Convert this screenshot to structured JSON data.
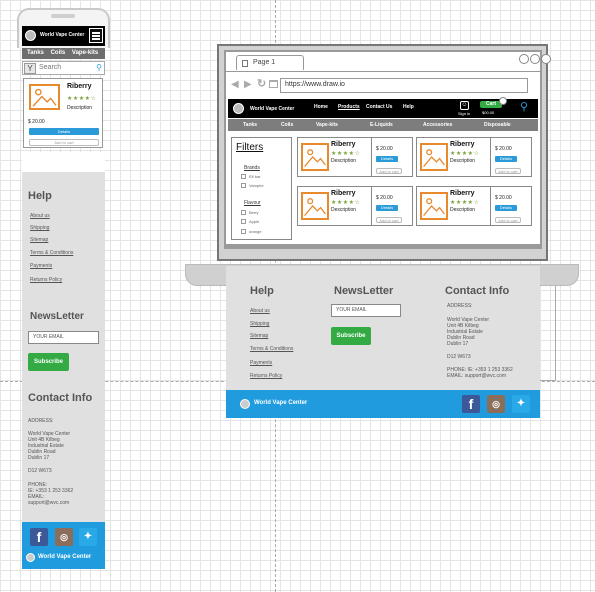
{
  "colors": {
    "accent_blue": "#1f9bde",
    "subscribe_green": "#33aa44",
    "image_orange": "#e8892e",
    "star_green": "#7aa33c",
    "footer_gray": "#e0e0e0"
  },
  "phone": {
    "brand": "World Vape Center",
    "nav": [
      "Tanks",
      "Coils",
      "Vape-kits"
    ],
    "search_placeholder": "Search",
    "product": {
      "title": "Riberry",
      "stars": "★★★★☆",
      "description": "Description",
      "price": "$ 20.00",
      "details_label": "Details",
      "cart_label": "Add to cart"
    },
    "help": {
      "heading": "Help",
      "links": [
        "About us",
        "Shipping",
        "Sitemap",
        "Terms & Conditions",
        "Payments",
        "Returns Policy"
      ]
    },
    "newsletter": {
      "heading": "NewsLetter",
      "email_placeholder": "YOUR EMAIL",
      "subscribe_label": "Subscribe"
    },
    "contact": {
      "heading": "Contact Info",
      "address_label": "ADDRESS:",
      "address_lines": [
        "World Vape Center",
        "Unit 4B Kilbeg",
        " Industrial Estate",
        "Dublin Road",
        "Dublin 17"
      ],
      "postcode": "D12 W673",
      "phone_label": "PHONE:",
      "phone": "IE: +353 1 253 3362",
      "email_label": "EMAIL:",
      "email": "support@wvc.com"
    },
    "footer_brand": "World Vape Center"
  },
  "laptop": {
    "tab_title": "Page 1",
    "url": "https://www.draw.io",
    "brand": "World Vape Center",
    "menu": [
      "Home",
      "Products",
      "Contact Us",
      "Help"
    ],
    "signin_label": "Sign in",
    "cart_label": "Cart",
    "cart_amount": "$00.00",
    "categories": [
      "Tanks",
      "Coils",
      "Vape-kits",
      "E-Liquids",
      "Accessories",
      "Disposable"
    ],
    "filters": {
      "heading": "Filters",
      "brands_label": "Brands",
      "brand_options": [
        "Elf bar",
        "Vampire"
      ],
      "flavour_label": "Flavour",
      "flavour_options": [
        "Berry",
        "Apple",
        "orange"
      ]
    },
    "products": [
      {
        "title": "Riberry",
        "stars": "★★★★☆",
        "description": "Description",
        "price": "$ 20.00",
        "details_label": "Details",
        "cart_label": "Add to cart"
      },
      {
        "title": "Riberry",
        "stars": "★★★★☆",
        "description": "Description",
        "price": "$ 20.00",
        "details_label": "Details",
        "cart_label": "Add to cart"
      },
      {
        "title": "Riberry",
        "stars": "★★★★☆",
        "description": "Description",
        "price": "$ 20.00",
        "details_label": "Details",
        "cart_label": "Add to cart"
      },
      {
        "title": "Riberry",
        "stars": "★★★★☆",
        "description": "Description",
        "price": "$ 20.00",
        "details_label": "Details",
        "cart_label": "Add to cart"
      }
    ],
    "help": {
      "heading": "Help",
      "links": [
        "About us",
        "Shipping",
        "Sitemap",
        "Terms & Conditions",
        "Payments",
        "Returns Policy"
      ]
    },
    "newsletter": {
      "heading": "NewsLetter",
      "email_placeholder": "YOUR EMAIL",
      "subscribe_label": "Subscribe"
    },
    "contact": {
      "heading": "Contact Info",
      "address_label": "ADDRESS:",
      "address_lines": [
        "World Vape Center",
        "Unit 4B Kilbeg",
        " Industrial Estate",
        "Dublin Road",
        "Dublin 17"
      ],
      "postcode": "D12 W673",
      "phone": "PHONE: IE: +353 1 253 3362",
      "email": "EMAIL: support@wvc.com"
    },
    "footer_brand": "World Vape Center"
  }
}
